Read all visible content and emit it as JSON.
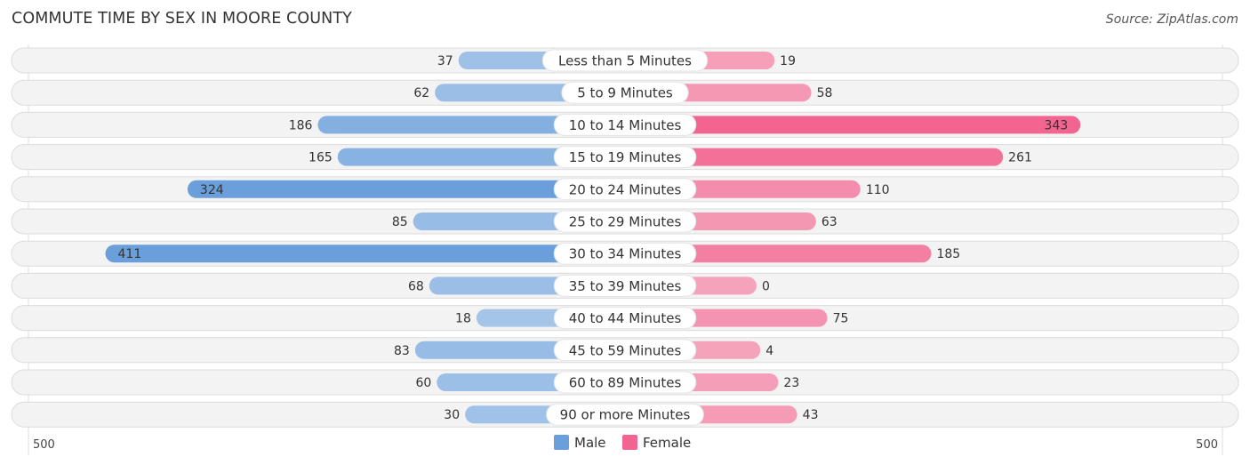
{
  "chart_data": {
    "type": "bar",
    "orientation": "horizontal-diverging",
    "title": "COMMUTE TIME BY SEX IN MOORE COUNTY",
    "source": "Source: ZipAtlas.com",
    "categories": [
      "Less than 5 Minutes",
      "5 to 9 Minutes",
      "10 to 14 Minutes",
      "15 to 19 Minutes",
      "20 to 24 Minutes",
      "25 to 29 Minutes",
      "30 to 34 Minutes",
      "35 to 39 Minutes",
      "40 to 44 Minutes",
      "45 to 59 Minutes",
      "60 to 89 Minutes",
      "90 or more Minutes"
    ],
    "series": [
      {
        "name": "Male",
        "color": "#6a9fdc",
        "light_color": "#a7c6e9",
        "values": [
          37,
          62,
          186,
          165,
          324,
          85,
          411,
          68,
          18,
          83,
          60,
          30
        ]
      },
      {
        "name": "Female",
        "color": "#f26591",
        "light_color": "#f5a3bc",
        "values": [
          19,
          58,
          343,
          261,
          110,
          63,
          185,
          0,
          75,
          4,
          23,
          43
        ]
      }
    ],
    "axis": {
      "left_label": "500",
      "right_label": "500",
      "max": 500
    },
    "legend": {
      "position": "bottom-center",
      "items": [
        "Male",
        "Female"
      ]
    },
    "xlabel": "",
    "ylabel": ""
  }
}
